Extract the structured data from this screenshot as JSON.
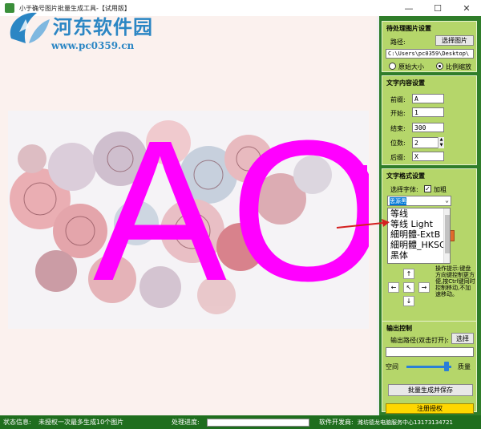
{
  "window": {
    "title": "小于确号图片批量生成工具-【试用版】",
    "minimize": "—",
    "maximize": "☐",
    "close": "✕"
  },
  "watermark": {
    "title": "河东软件园",
    "url": "www.pc0359.cn"
  },
  "canvas": {
    "text_overlay": "AO",
    "text_color": "#ff00ff"
  },
  "image_source": {
    "title": "待处理图片设置",
    "path_label": "路径:",
    "select_button": "选择图片",
    "path_value": "C:\\Users\\pc0359\\Desktop\\",
    "original_size_label": "原始大小",
    "scale_label": "比例缩放",
    "scale_selected": true
  },
  "text_content": {
    "title": "文字内容设置",
    "prefix_label": "前缀:",
    "prefix_value": "A",
    "start_label": "开始:",
    "start_value": "1",
    "end_label": "结束:",
    "end_value": "300",
    "digits_label": "位数:",
    "digits_value": "2",
    "suffix_label": "后缀:",
    "suffix_value": "X"
  },
  "text_format": {
    "title": "文字格式设置",
    "font_label": "选择字体:",
    "bold_label": "加粗",
    "bold_checked": true,
    "font_selected": "思源黑",
    "font_options": [
      "等线",
      "等线 Light",
      "細明體-ExtB",
      "細明體_HKSCS",
      "黑体"
    ]
  },
  "position": {
    "up": "↑",
    "left": "←",
    "center": "↖",
    "right": "→",
    "down": "↓",
    "hint": "操作提示:键盘方向键控制更方便,按Ctrl键同时控制移动,不加速移动。"
  },
  "output": {
    "title": "输出控制",
    "path_label": "输出路径(双击打开):",
    "select_button": "选择",
    "path_value": "",
    "space_label": "空间",
    "quality_label": "质量",
    "quality_fraction": 0.9,
    "generate_button": "批量生成并保存"
  },
  "register_button": "注册授权",
  "status": {
    "info_label": "状态信息:",
    "info_value": "未授权一次最多生成10个图片",
    "progress_label": "处理进度:",
    "progress_fraction": 0,
    "developer_label": "软件开发商:",
    "developer_value": "潍坊德龙电脑服务中心13173134721"
  }
}
